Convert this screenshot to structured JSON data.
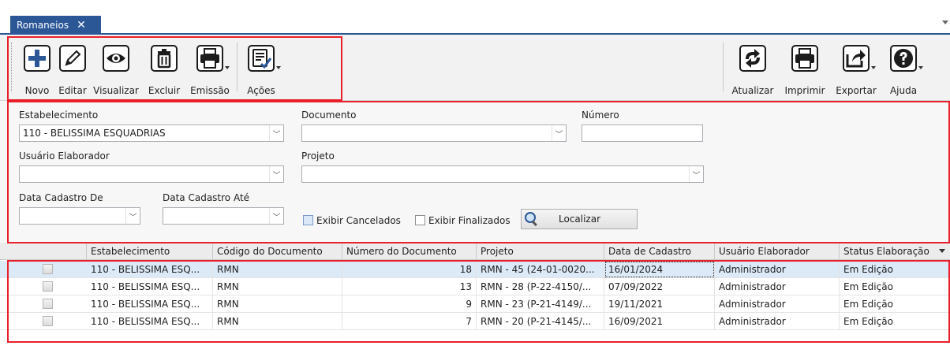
{
  "tab": {
    "title": "Romaneios",
    "close_glyph": "✕"
  },
  "toolbar": {
    "left_buttons": [
      {
        "label": "Novo",
        "icon": "plus-icon"
      },
      {
        "label": "Editar",
        "icon": "pencil-icon"
      },
      {
        "label": "Visualizar",
        "icon": "eye-icon"
      },
      {
        "label": "Excluir",
        "icon": "trash-icon"
      },
      {
        "label": "Emissão",
        "icon": "printer-icon"
      }
    ],
    "actions_button": {
      "label": "Ações",
      "icon": "checklist-icon"
    },
    "right_buttons": [
      {
        "label": "Atualizar",
        "icon": "refresh-icon"
      },
      {
        "label": "Imprimir",
        "icon": "printer-icon"
      },
      {
        "label": "Exportar",
        "icon": "export-icon"
      },
      {
        "label": "Ajuda",
        "icon": "help-icon"
      }
    ]
  },
  "filters": {
    "estabelecimento": {
      "label": "Estabelecimento",
      "value": "110 - BELISSIMA ESQUADRIAS"
    },
    "documento": {
      "label": "Documento",
      "value": ""
    },
    "numero": {
      "label": "Número",
      "value": ""
    },
    "usuario": {
      "label": "Usuário Elaborador",
      "value": ""
    },
    "projeto": {
      "label": "Projeto",
      "value": ""
    },
    "data_de": {
      "label": "Data Cadastro De",
      "value": ""
    },
    "data_ate": {
      "label": "Data Cadastro Até",
      "value": ""
    },
    "exibir_cancelados": {
      "label": "Exibir Cancelados"
    },
    "exibir_finalizados": {
      "label": "Exibir Finalizados"
    },
    "localizar": {
      "label": "Localizar"
    }
  },
  "grid": {
    "columns": [
      "Estabelecimento",
      "Código do Documento",
      "Número do Documento",
      "Projeto",
      "Data de Cadastro",
      "Usuário Elaborador",
      "Status Elaboração"
    ],
    "rows": [
      {
        "estabelecimento": "110 - BELISSIMA ESQ...",
        "codigo": "RMN",
        "numero": "18",
        "projeto": "RMN - 45 (24-01-0020...",
        "data": "16/01/2024",
        "usuario": "Administrador",
        "status": "Em Edição"
      },
      {
        "estabelecimento": "110 - BELISSIMA ESQ...",
        "codigo": "RMN",
        "numero": "13",
        "projeto": "RMN - 28 (P-22-4150/...",
        "data": "07/09/2022",
        "usuario": "Administrador",
        "status": "Em Edição"
      },
      {
        "estabelecimento": "110 - BELISSIMA ESQ...",
        "codigo": "RMN",
        "numero": "9",
        "projeto": "RMN - 23 (P-21-4149/...",
        "data": "19/11/2021",
        "usuario": "Administrador",
        "status": "Em Edição"
      },
      {
        "estabelecimento": "110 - BELISSIMA ESQ...",
        "codigo": "RMN",
        "numero": "7",
        "projeto": "RMN - 20 (P-21-4145/...",
        "data": "16/09/2021",
        "usuario": "Administrador",
        "status": "Em Edição"
      }
    ]
  },
  "colors": {
    "accent": "#2b5797",
    "highlight": "#e8202a",
    "selected_row": "#dce9f7"
  }
}
